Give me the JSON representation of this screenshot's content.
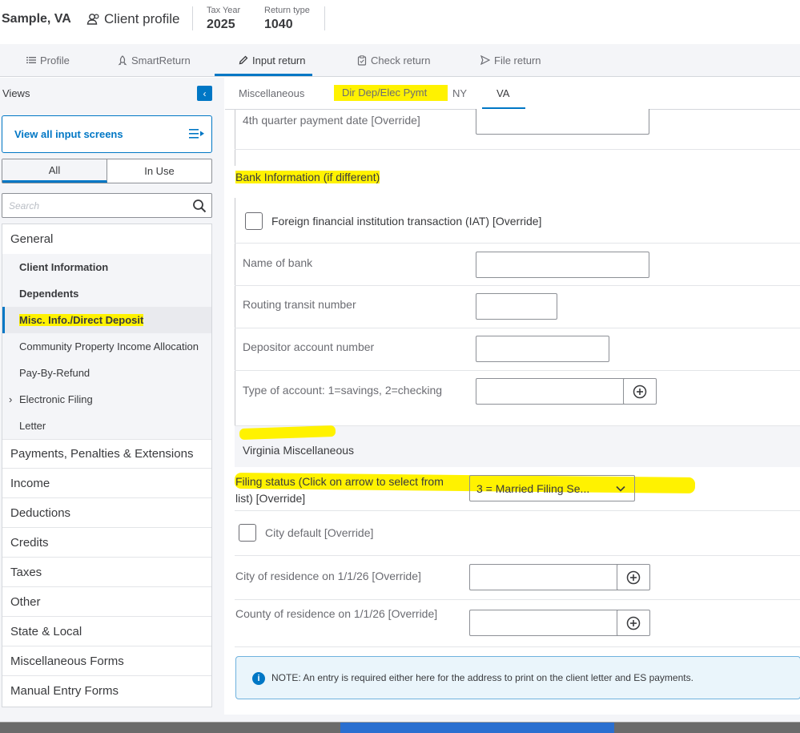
{
  "header": {
    "client_name": "Sample, VA",
    "profile_label": "Client profile",
    "tax_year_label": "Tax Year",
    "tax_year": "2025",
    "return_type_label": "Return type",
    "return_type": "1040"
  },
  "nav": {
    "items": [
      {
        "label": "Profile",
        "icon": "list-icon"
      },
      {
        "label": "SmartReturn",
        "icon": "rocket-icon"
      },
      {
        "label": "Input return",
        "icon": "pencil-icon"
      },
      {
        "label": "Check return",
        "icon": "clipboard-icon"
      },
      {
        "label": "File return",
        "icon": "send-icon"
      }
    ],
    "active": "Input return"
  },
  "sidebar": {
    "views_label": "Views",
    "view_all_label": "View all input screens",
    "segments": [
      "All",
      "In Use"
    ],
    "search_placeholder": "Search",
    "groups": [
      {
        "label": "General"
      },
      {
        "label": "Payments, Penalties & Extensions"
      },
      {
        "label": "Income"
      },
      {
        "label": "Deductions"
      },
      {
        "label": "Credits"
      },
      {
        "label": "Taxes"
      },
      {
        "label": "Other"
      },
      {
        "label": "State & Local"
      },
      {
        "label": "Miscellaneous Forms"
      },
      {
        "label": "Manual Entry Forms"
      }
    ],
    "general_items": [
      "Client Information",
      "Dependents",
      "Misc. Info./Direct Deposit",
      "Community Property Income Allocation",
      "Pay-By-Refund",
      "Electronic Filing",
      "Letter"
    ],
    "selected_item": "Misc. Info./Direct Deposit"
  },
  "tabs": [
    "Miscellaneous",
    "Dir Dep/Elec Pymt",
    "NY",
    "VA"
  ],
  "active_tab": "VA",
  "form": {
    "q4_payment_label": "4th quarter payment date [Override]",
    "bank_section_title": "Bank Information (if different)",
    "iat_label": "Foreign financial institution transaction (IAT) [Override]",
    "bank_name_label": "Name of bank",
    "routing_label": "Routing transit number",
    "account_label": "Depositor account number",
    "account_type_label": "Type of account: 1=savings, 2=checking",
    "va_section_title": "Virginia Miscellaneous",
    "filing_status_label": "Filing status (Click on arrow to select from list) [Override]",
    "filing_status_value": "3 = Married Filing Se...",
    "city_default_label": "City default [Override]",
    "city_residence_label": "City of residence on 1/1/26 [Override]",
    "county_residence_label": "County of residence on 1/1/26 [Override]",
    "note_text": "NOTE: An entry is required either here for the address to print on the client letter and ES payments."
  },
  "colors": {
    "accent": "#0077c5",
    "highlight": "#fff200",
    "text": "#393a3d",
    "muted": "#6b6c72"
  }
}
